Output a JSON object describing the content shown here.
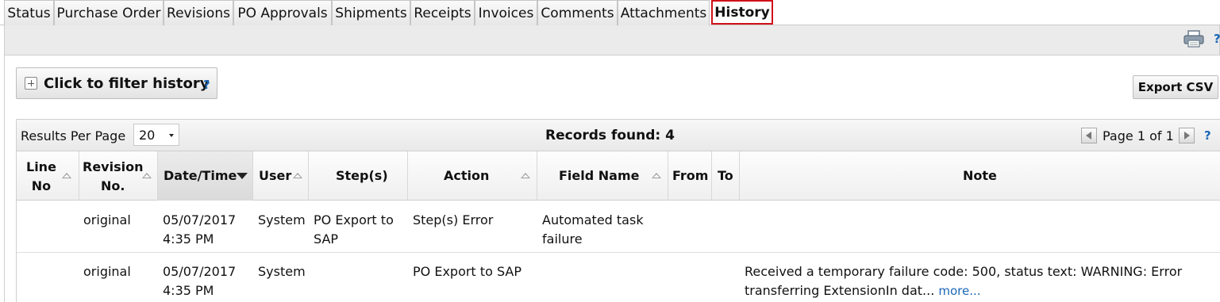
{
  "tabs": [
    {
      "label": "Status"
    },
    {
      "label": "Purchase Order"
    },
    {
      "label": "Revisions"
    },
    {
      "label": "PO Approvals"
    },
    {
      "label": "Shipments"
    },
    {
      "label": "Receipts"
    },
    {
      "label": "Invoices"
    },
    {
      "label": "Comments"
    },
    {
      "label": "Attachments"
    },
    {
      "label": "History",
      "active": true
    }
  ],
  "toolbar": {
    "print_icon": "printer-icon",
    "help": "?"
  },
  "filter": {
    "label": "Click to filter history",
    "help": "?",
    "icon": "plus-box-icon"
  },
  "export": {
    "label": "Export CSV"
  },
  "pager": {
    "rpp_label": "Results Per Page",
    "rpp_value": "20",
    "records": "Records found: 4",
    "page_text": "Page 1 of 1",
    "help": "?"
  },
  "columns": {
    "line_no": [
      "Line",
      "No"
    ],
    "revision_no": [
      "Revision",
      "No."
    ],
    "datetime": "Date/Time",
    "user": "User",
    "steps": "Step(s)",
    "action": "Action",
    "field_name": "Field Name",
    "from": "From",
    "to": "To",
    "note": "Note"
  },
  "rows": [
    {
      "line_no": "",
      "revision": "original",
      "date": "05/07/2017",
      "time": "4:35 PM",
      "user": "System",
      "steps": [
        "PO Export to",
        "SAP"
      ],
      "action": "Step(s) Error",
      "field_name": [
        "Automated task",
        "failure"
      ],
      "from": "",
      "to": "",
      "note": [
        "",
        ""
      ],
      "more": ""
    },
    {
      "line_no": "",
      "revision": "original",
      "date": "05/07/2017",
      "time": "4:35 PM",
      "user": "System",
      "steps": [
        "",
        ""
      ],
      "action": "PO Export to SAP",
      "field_name": [
        "",
        ""
      ],
      "from": "",
      "to": "",
      "note": [
        "Received a temporary failure code: 500, status text: WARNING: Error",
        "transferring ExtensionIn dat..."
      ],
      "more": "more..."
    }
  ],
  "colors": {
    "accent_link": "#1b67b5",
    "active_tab_border": "#d0101a"
  }
}
